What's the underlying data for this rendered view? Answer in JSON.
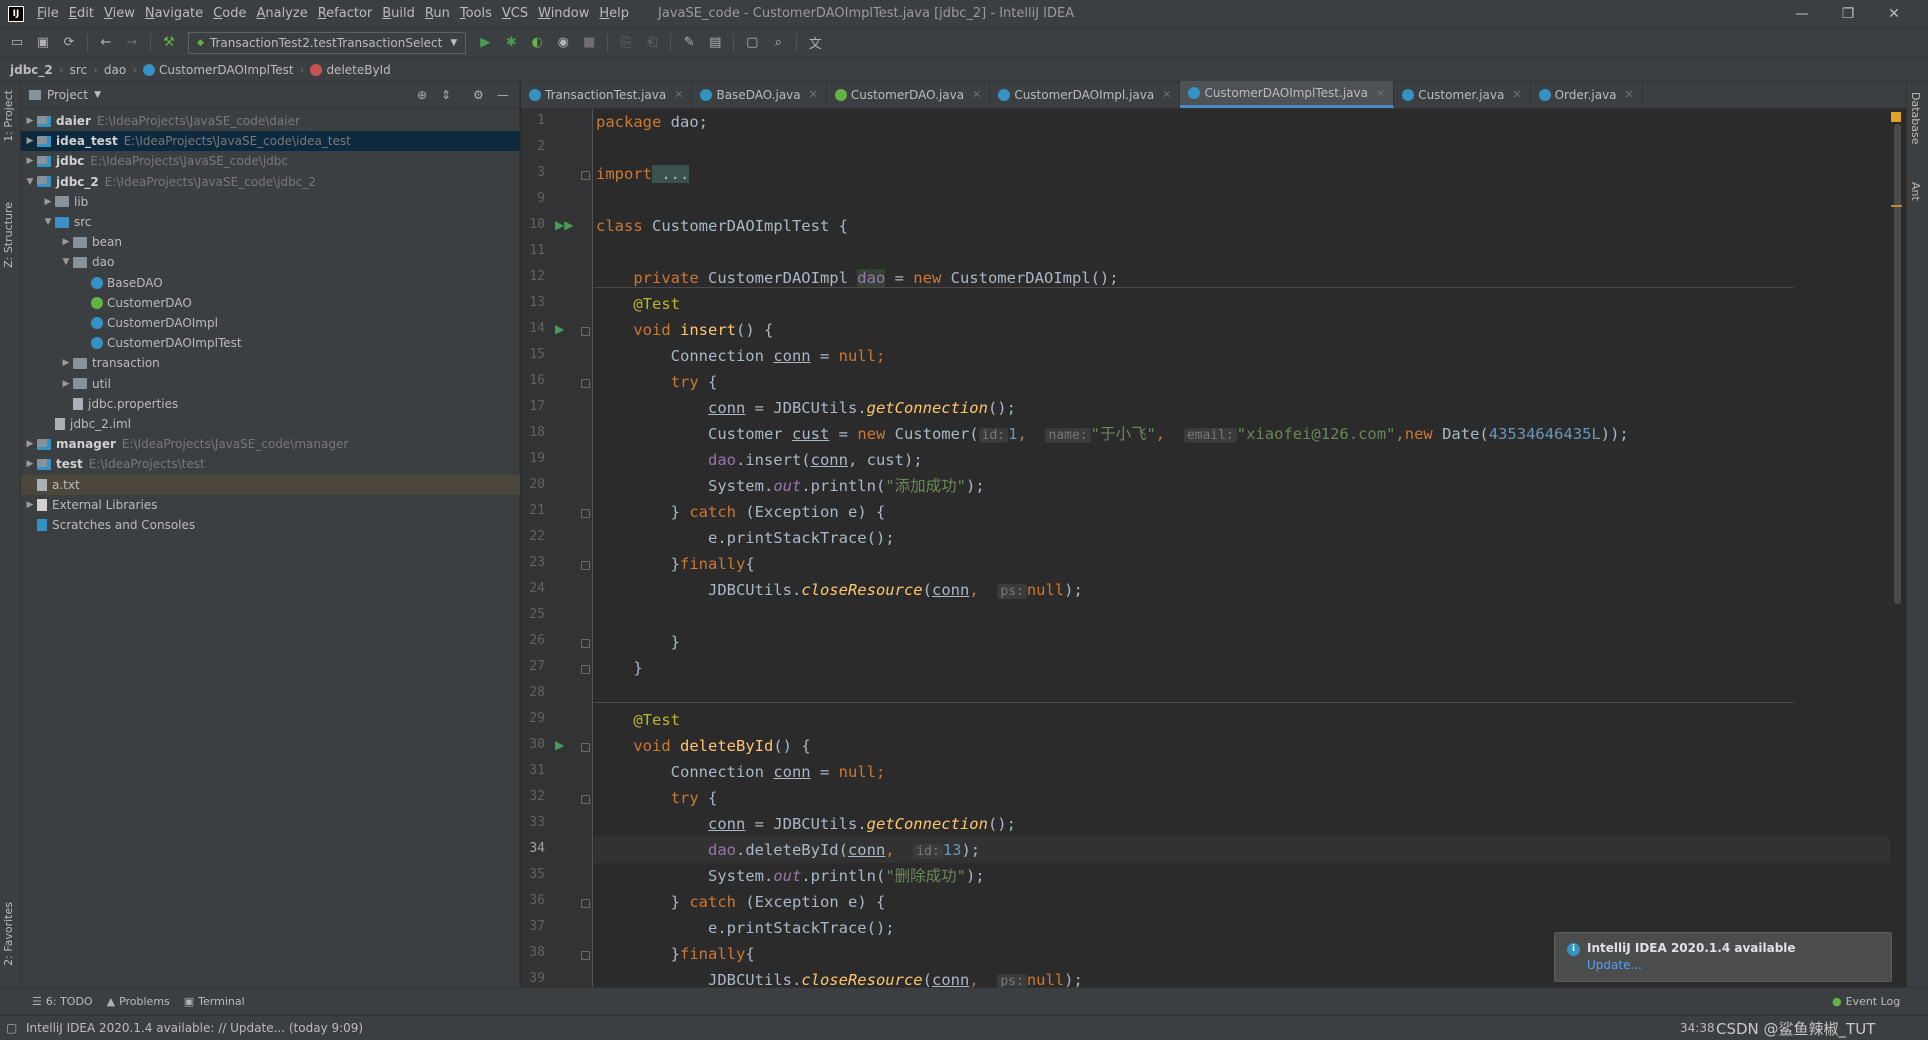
{
  "window": {
    "title": "JavaSE_code - CustomerDAOImplTest.java [jdbc_2] - IntelliJ IDEA",
    "controls": [
      "—",
      "❐",
      "✕"
    ]
  },
  "menu": [
    "File",
    "Edit",
    "View",
    "Navigate",
    "Code",
    "Analyze",
    "Refactor",
    "Build",
    "Run",
    "Tools",
    "VCS",
    "Window",
    "Help"
  ],
  "toolbar": {
    "run_config": "TransactionTest2.testTransactionSelect"
  },
  "breadcrumb": [
    "jdbc_2",
    "src",
    "dao",
    "CustomerDAOImplTest",
    "deleteById"
  ],
  "project_panel": {
    "title": "Project",
    "tree": [
      {
        "label": "daier",
        "path": "E:\\IdeaProjects\\JavaSE_code\\daier",
        "indent": 0,
        "arrow": "▶",
        "kind": "module"
      },
      {
        "label": "idea_test",
        "path": "E:\\IdeaProjects\\JavaSE_code\\idea_test",
        "indent": 0,
        "arrow": "▶",
        "kind": "module",
        "selected": true
      },
      {
        "label": "jdbc",
        "path": "E:\\IdeaProjects\\JavaSE_code\\jdbc",
        "indent": 0,
        "arrow": "▶",
        "kind": "module"
      },
      {
        "label": "jdbc_2",
        "path": "E:\\IdeaProjects\\JavaSE_code\\jdbc_2",
        "indent": 0,
        "arrow": "▼",
        "kind": "module"
      },
      {
        "label": "lib",
        "path": "",
        "indent": 1,
        "arrow": "▶",
        "kind": "folder"
      },
      {
        "label": "src",
        "path": "",
        "indent": 1,
        "arrow": "▼",
        "kind": "src"
      },
      {
        "label": "bean",
        "path": "",
        "indent": 2,
        "arrow": "▶",
        "kind": "folder"
      },
      {
        "label": "dao",
        "path": "",
        "indent": 2,
        "arrow": "▼",
        "kind": "folder"
      },
      {
        "label": "BaseDAO",
        "path": "",
        "indent": 3,
        "arrow": "",
        "kind": "class"
      },
      {
        "label": "CustomerDAO",
        "path": "",
        "indent": 3,
        "arrow": "",
        "kind": "interface"
      },
      {
        "label": "CustomerDAOImpl",
        "path": "",
        "indent": 3,
        "arrow": "",
        "kind": "class"
      },
      {
        "label": "CustomerDAOImplTest",
        "path": "",
        "indent": 3,
        "arrow": "",
        "kind": "class"
      },
      {
        "label": "transaction",
        "path": "",
        "indent": 2,
        "arrow": "▶",
        "kind": "folder"
      },
      {
        "label": "util",
        "path": "",
        "indent": 2,
        "arrow": "▶",
        "kind": "folder"
      },
      {
        "label": "jdbc.properties",
        "path": "",
        "indent": 2,
        "arrow": "",
        "kind": "file"
      },
      {
        "label": "jdbc_2.iml",
        "path": "",
        "indent": 1,
        "arrow": "",
        "kind": "file"
      },
      {
        "label": "manager",
        "path": "E:\\IdeaProjects\\JavaSE_code\\manager",
        "indent": 0,
        "arrow": "▶",
        "kind": "module"
      },
      {
        "label": "test",
        "path": "E:\\IdeaProjects\\test",
        "indent": 0,
        "arrow": "▶",
        "kind": "module"
      },
      {
        "label": "a.txt",
        "path": "",
        "indent": 0,
        "arrow": "",
        "kind": "file",
        "highlight": true
      },
      {
        "label": "External Libraries",
        "path": "",
        "indent": 0,
        "arrow": "▶",
        "kind": "lib"
      },
      {
        "label": "Scratches and Consoles",
        "path": "",
        "indent": 0,
        "arrow": "",
        "kind": "scratch"
      }
    ]
  },
  "tabs": [
    {
      "label": "TransactionTest.java",
      "kind": "class"
    },
    {
      "label": "BaseDAO.java",
      "kind": "class"
    },
    {
      "label": "CustomerDAO.java",
      "kind": "interface"
    },
    {
      "label": "CustomerDAOImpl.java",
      "kind": "class"
    },
    {
      "label": "CustomerDAOImplTest.java",
      "kind": "class",
      "active": true
    },
    {
      "label": "Customer.java",
      "kind": "class"
    },
    {
      "label": "Order.java",
      "kind": "class"
    }
  ],
  "editor": {
    "line_numbers": [
      1,
      2,
      3,
      9,
      10,
      11,
      12,
      13,
      14,
      15,
      16,
      17,
      18,
      19,
      20,
      21,
      22,
      23,
      24,
      25,
      26,
      27,
      28,
      29,
      30,
      31,
      32,
      33,
      34,
      35,
      36,
      37,
      38,
      39
    ],
    "current_line": 34,
    "code": {
      "l1_kw": "package",
      "l1_rest": " dao;",
      "l3_kw": "import",
      "l3_fold": " ...",
      "l10_kw": "class",
      "l10_rest": " CustomerDAOImplTest {",
      "l12_kw1": "private",
      "l12_t": " CustomerDAOImpl ",
      "l12_f": "dao",
      "l12_eq": " = ",
      "l12_kw2": "new",
      "l12_rest": " CustomerDAOImpl();",
      "an_test": "@Test",
      "l14_kw": "void",
      "l14_fn": "insert",
      "l14_rest": "() {",
      "conn_decl_t": "Connection ",
      "conn": "conn",
      "conn_eq": " = ",
      "null": "null",
      "semi": ";",
      "try": "try",
      "brace_open": " {",
      "get_conn_rest": " = JDBCUtils.",
      "getConnection": "getConnection",
      "paren_semi": "();",
      "l18_a": "Customer ",
      "l18_cust": "cust",
      "l18_b": " = ",
      "l18_new": "new",
      "l18_c": " Customer(",
      "h_id": "id:",
      "l18_n1": "1",
      "comma": ", ",
      "h_name": "name:",
      "l18_s1": "\"于小飞\"",
      "h_email": "email:",
      "l18_s2": "\"xiaofei@126.com\"",
      "l18_new2": "new",
      "l18_d": " Date(",
      "l18_n2": "43534646435L",
      "l18_e": "));",
      "dao": "dao",
      "l19_rest": ".insert(",
      "l19_rest2": ", cust);",
      "sys": "System.",
      "out": "out",
      "println": ".println(",
      "l20_s": "\"添加成功\"",
      "close_paren_semi": ");",
      "catch_open": "} ",
      "catch": "catch",
      "catch_rest": " (Exception e) {",
      "pst": "e.printStackTrace();",
      "finally_open": "}",
      "finally": "finally",
      "finally_rest": "{",
      "util": "JDBCUtils.",
      "closeResource": "closeResource",
      "paren": "(",
      "h_ps": "ps:",
      "close": "}",
      "l30_fn": "deleteById",
      "l34_rest": ".deleteById(",
      "l34_n": "13",
      "l35_s": "\"删除成功\""
    }
  },
  "notification": {
    "title": "IntelliJ IDEA 2020.1.4 available",
    "link": "Update..."
  },
  "tool_windows": {
    "left": [
      "1: Project",
      "Z: Structure",
      "2: Favorites"
    ],
    "right": [
      "Database",
      "Ant"
    ],
    "bottom": [
      "6: TODO",
      "Problems",
      "Terminal"
    ],
    "event_log": "Event Log"
  },
  "status": {
    "message": "IntelliJ IDEA 2020.1.4 available: // Update... (today 9:09)",
    "position": "34:38",
    "watermark": "CSDN @鲨鱼辣椒_TUT"
  }
}
